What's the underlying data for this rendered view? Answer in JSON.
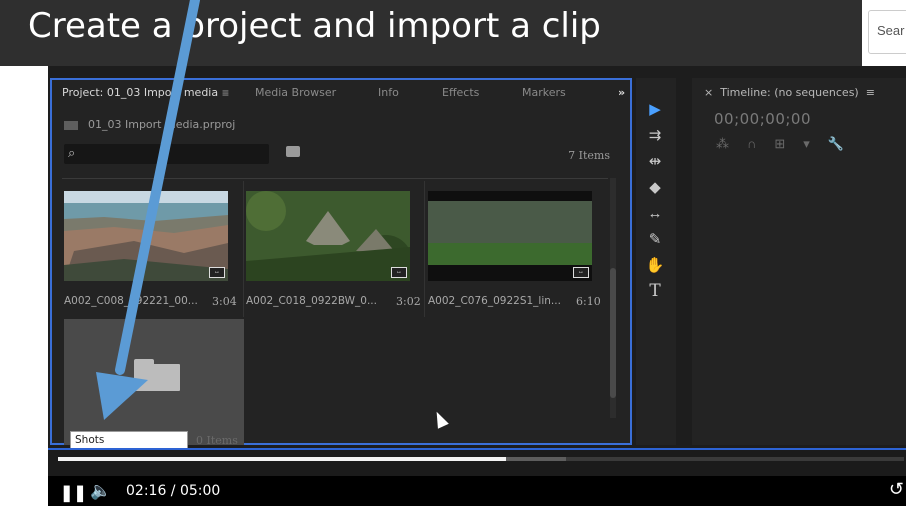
{
  "title": "Create a project and import a clip",
  "search": {
    "placeholder": "Sear"
  },
  "project_panel": {
    "tabs": [
      {
        "label": "Project: 01_03 Import media"
      },
      {
        "label": "Media Browser"
      },
      {
        "label": "Info"
      },
      {
        "label": "Effects"
      },
      {
        "label": "Markers"
      }
    ],
    "overflow_icon": "»",
    "file_name": "01_03 Import media.prproj",
    "item_count": "7 Items",
    "clips": [
      {
        "name": "A002_C008_092221_00...",
        "duration": "3:04"
      },
      {
        "name": "A002_C018_0922BW_0...",
        "duration": "3:02"
      },
      {
        "name": "A002_C076_0922S1_lin...",
        "duration": "6:10"
      }
    ],
    "bin": {
      "name": "Shots",
      "count": "0 Items"
    }
  },
  "tools": [
    "selection-tool",
    "track-select-tool",
    "ripple-edit-tool",
    "razor-tool",
    "slip-tool",
    "pen-tool",
    "hand-tool",
    "type-tool"
  ],
  "timeline": {
    "title": "Timeline: (no sequences)",
    "close": "×",
    "menu": "≡",
    "timecode": "00;00;00;00"
  },
  "player": {
    "progress": 0.53,
    "buffered": 0.6,
    "current_time": "02:16",
    "separator": " / ",
    "total_time": "05:00"
  },
  "colors": {
    "accent": "#3a6fd8",
    "annotation_arrow": "#5b9bd5",
    "selection_tool": "#4aa0ff"
  }
}
